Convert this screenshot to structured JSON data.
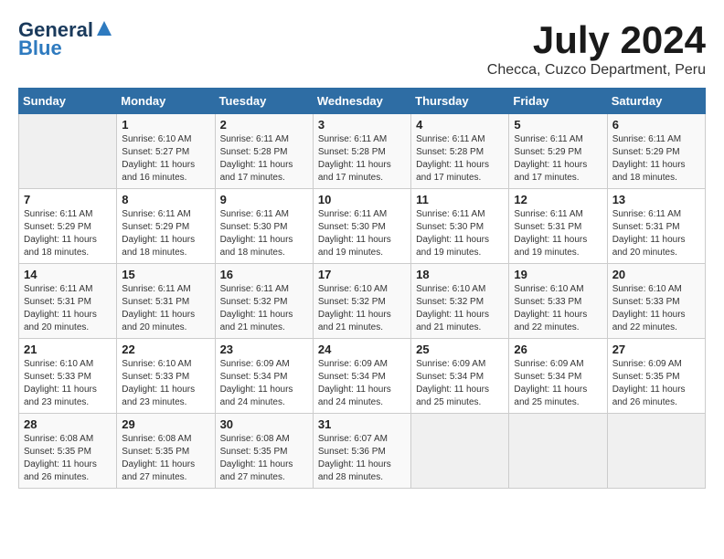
{
  "logo": {
    "general": "General",
    "blue": "Blue"
  },
  "title": {
    "month": "July 2024",
    "location": "Checca, Cuzco Department, Peru"
  },
  "weekdays": [
    "Sunday",
    "Monday",
    "Tuesday",
    "Wednesday",
    "Thursday",
    "Friday",
    "Saturday"
  ],
  "weeks": [
    [
      {
        "day": "",
        "sunrise": "",
        "sunset": "",
        "daylight": ""
      },
      {
        "day": "1",
        "sunrise": "Sunrise: 6:10 AM",
        "sunset": "Sunset: 5:27 PM",
        "daylight": "Daylight: 11 hours and 16 minutes."
      },
      {
        "day": "2",
        "sunrise": "Sunrise: 6:11 AM",
        "sunset": "Sunset: 5:28 PM",
        "daylight": "Daylight: 11 hours and 17 minutes."
      },
      {
        "day": "3",
        "sunrise": "Sunrise: 6:11 AM",
        "sunset": "Sunset: 5:28 PM",
        "daylight": "Daylight: 11 hours and 17 minutes."
      },
      {
        "day": "4",
        "sunrise": "Sunrise: 6:11 AM",
        "sunset": "Sunset: 5:28 PM",
        "daylight": "Daylight: 11 hours and 17 minutes."
      },
      {
        "day": "5",
        "sunrise": "Sunrise: 6:11 AM",
        "sunset": "Sunset: 5:29 PM",
        "daylight": "Daylight: 11 hours and 17 minutes."
      },
      {
        "day": "6",
        "sunrise": "Sunrise: 6:11 AM",
        "sunset": "Sunset: 5:29 PM",
        "daylight": "Daylight: 11 hours and 18 minutes."
      }
    ],
    [
      {
        "day": "7",
        "sunrise": "Sunrise: 6:11 AM",
        "sunset": "Sunset: 5:29 PM",
        "daylight": "Daylight: 11 hours and 18 minutes."
      },
      {
        "day": "8",
        "sunrise": "Sunrise: 6:11 AM",
        "sunset": "Sunset: 5:29 PM",
        "daylight": "Daylight: 11 hours and 18 minutes."
      },
      {
        "day": "9",
        "sunrise": "Sunrise: 6:11 AM",
        "sunset": "Sunset: 5:30 PM",
        "daylight": "Daylight: 11 hours and 18 minutes."
      },
      {
        "day": "10",
        "sunrise": "Sunrise: 6:11 AM",
        "sunset": "Sunset: 5:30 PM",
        "daylight": "Daylight: 11 hours and 19 minutes."
      },
      {
        "day": "11",
        "sunrise": "Sunrise: 6:11 AM",
        "sunset": "Sunset: 5:30 PM",
        "daylight": "Daylight: 11 hours and 19 minutes."
      },
      {
        "day": "12",
        "sunrise": "Sunrise: 6:11 AM",
        "sunset": "Sunset: 5:31 PM",
        "daylight": "Daylight: 11 hours and 19 minutes."
      },
      {
        "day": "13",
        "sunrise": "Sunrise: 6:11 AM",
        "sunset": "Sunset: 5:31 PM",
        "daylight": "Daylight: 11 hours and 20 minutes."
      }
    ],
    [
      {
        "day": "14",
        "sunrise": "Sunrise: 6:11 AM",
        "sunset": "Sunset: 5:31 PM",
        "daylight": "Daylight: 11 hours and 20 minutes."
      },
      {
        "day": "15",
        "sunrise": "Sunrise: 6:11 AM",
        "sunset": "Sunset: 5:31 PM",
        "daylight": "Daylight: 11 hours and 20 minutes."
      },
      {
        "day": "16",
        "sunrise": "Sunrise: 6:11 AM",
        "sunset": "Sunset: 5:32 PM",
        "daylight": "Daylight: 11 hours and 21 minutes."
      },
      {
        "day": "17",
        "sunrise": "Sunrise: 6:10 AM",
        "sunset": "Sunset: 5:32 PM",
        "daylight": "Daylight: 11 hours and 21 minutes."
      },
      {
        "day": "18",
        "sunrise": "Sunrise: 6:10 AM",
        "sunset": "Sunset: 5:32 PM",
        "daylight": "Daylight: 11 hours and 21 minutes."
      },
      {
        "day": "19",
        "sunrise": "Sunrise: 6:10 AM",
        "sunset": "Sunset: 5:33 PM",
        "daylight": "Daylight: 11 hours and 22 minutes."
      },
      {
        "day": "20",
        "sunrise": "Sunrise: 6:10 AM",
        "sunset": "Sunset: 5:33 PM",
        "daylight": "Daylight: 11 hours and 22 minutes."
      }
    ],
    [
      {
        "day": "21",
        "sunrise": "Sunrise: 6:10 AM",
        "sunset": "Sunset: 5:33 PM",
        "daylight": "Daylight: 11 hours and 23 minutes."
      },
      {
        "day": "22",
        "sunrise": "Sunrise: 6:10 AM",
        "sunset": "Sunset: 5:33 PM",
        "daylight": "Daylight: 11 hours and 23 minutes."
      },
      {
        "day": "23",
        "sunrise": "Sunrise: 6:09 AM",
        "sunset": "Sunset: 5:34 PM",
        "daylight": "Daylight: 11 hours and 24 minutes."
      },
      {
        "day": "24",
        "sunrise": "Sunrise: 6:09 AM",
        "sunset": "Sunset: 5:34 PM",
        "daylight": "Daylight: 11 hours and 24 minutes."
      },
      {
        "day": "25",
        "sunrise": "Sunrise: 6:09 AM",
        "sunset": "Sunset: 5:34 PM",
        "daylight": "Daylight: 11 hours and 25 minutes."
      },
      {
        "day": "26",
        "sunrise": "Sunrise: 6:09 AM",
        "sunset": "Sunset: 5:34 PM",
        "daylight": "Daylight: 11 hours and 25 minutes."
      },
      {
        "day": "27",
        "sunrise": "Sunrise: 6:09 AM",
        "sunset": "Sunset: 5:35 PM",
        "daylight": "Daylight: 11 hours and 26 minutes."
      }
    ],
    [
      {
        "day": "28",
        "sunrise": "Sunrise: 6:08 AM",
        "sunset": "Sunset: 5:35 PM",
        "daylight": "Daylight: 11 hours and 26 minutes."
      },
      {
        "day": "29",
        "sunrise": "Sunrise: 6:08 AM",
        "sunset": "Sunset: 5:35 PM",
        "daylight": "Daylight: 11 hours and 27 minutes."
      },
      {
        "day": "30",
        "sunrise": "Sunrise: 6:08 AM",
        "sunset": "Sunset: 5:35 PM",
        "daylight": "Daylight: 11 hours and 27 minutes."
      },
      {
        "day": "31",
        "sunrise": "Sunrise: 6:07 AM",
        "sunset": "Sunset: 5:36 PM",
        "daylight": "Daylight: 11 hours and 28 minutes."
      },
      {
        "day": "",
        "sunrise": "",
        "sunset": "",
        "daylight": ""
      },
      {
        "day": "",
        "sunrise": "",
        "sunset": "",
        "daylight": ""
      },
      {
        "day": "",
        "sunrise": "",
        "sunset": "",
        "daylight": ""
      }
    ]
  ]
}
